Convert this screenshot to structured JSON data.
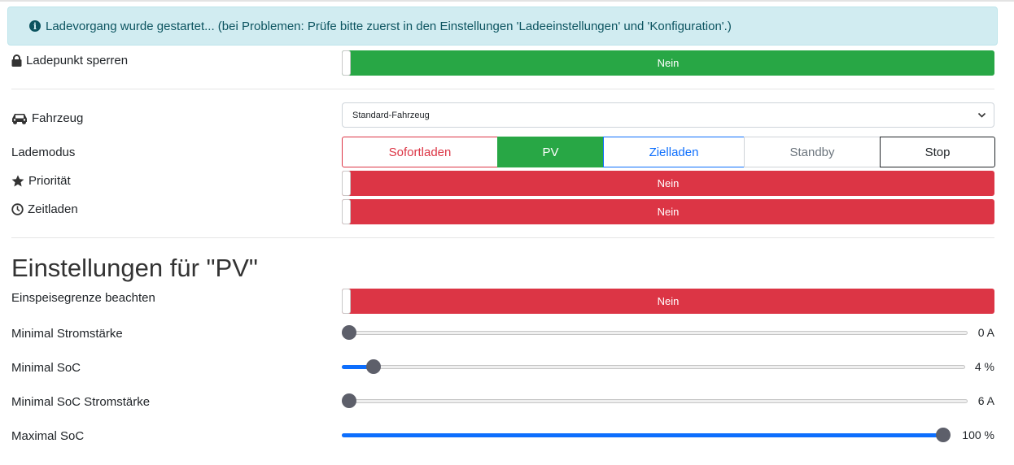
{
  "alert": {
    "text": "Ladevorgang wurde gestartet... (bei Problemen: Prüfe bitte zuerst in den Einstellungen 'Ladeeinstellungen' und 'Konfiguration'.)",
    "icon": "info-circle-icon",
    "color": "#0c5460"
  },
  "ladepunkt_sperren": {
    "label": "Ladepunkt sperren",
    "value": "Nein",
    "state_color": "#28a745"
  },
  "fahrzeug": {
    "label": "Fahrzeug",
    "selected": "Standard-Fahrzeug"
  },
  "lademodus": {
    "label": "Lademodus",
    "modes": [
      {
        "label": "Sofortladen",
        "color": "#dc3545",
        "active": false
      },
      {
        "label": "PV",
        "color": "#28a745",
        "active": true
      },
      {
        "label": "Zielladen",
        "color": "#0d6efd",
        "active": false
      },
      {
        "label": "Standby",
        "color": "#6c757d",
        "active": false
      },
      {
        "label": "Stop",
        "color": "#212529",
        "active": false
      }
    ]
  },
  "prioritaet": {
    "label": "Priorität",
    "value": "Nein",
    "state_color": "#dc3545"
  },
  "zeitladen": {
    "label": "Zeitladen",
    "value": "Nein",
    "state_color": "#dc3545"
  },
  "pv_settings": {
    "heading": "Einstellungen für \"PV\"",
    "einspeisegrenze": {
      "label": "Einspeisegrenze beachten",
      "value": "Nein",
      "state_color": "#dc3545"
    },
    "sliders": [
      {
        "label": "Minimal Stromstärke",
        "value_text": "0 A",
        "fraction": 0.0
      },
      {
        "label": "Minimal SoC",
        "value_text": "4 %",
        "fraction": 0.04
      },
      {
        "label": "Minimal SoC Stromstärke",
        "value_text": "6 A",
        "fraction": 0.0
      },
      {
        "label": "Maximal SoC",
        "value_text": "100 %",
        "fraction": 1.0
      }
    ]
  }
}
